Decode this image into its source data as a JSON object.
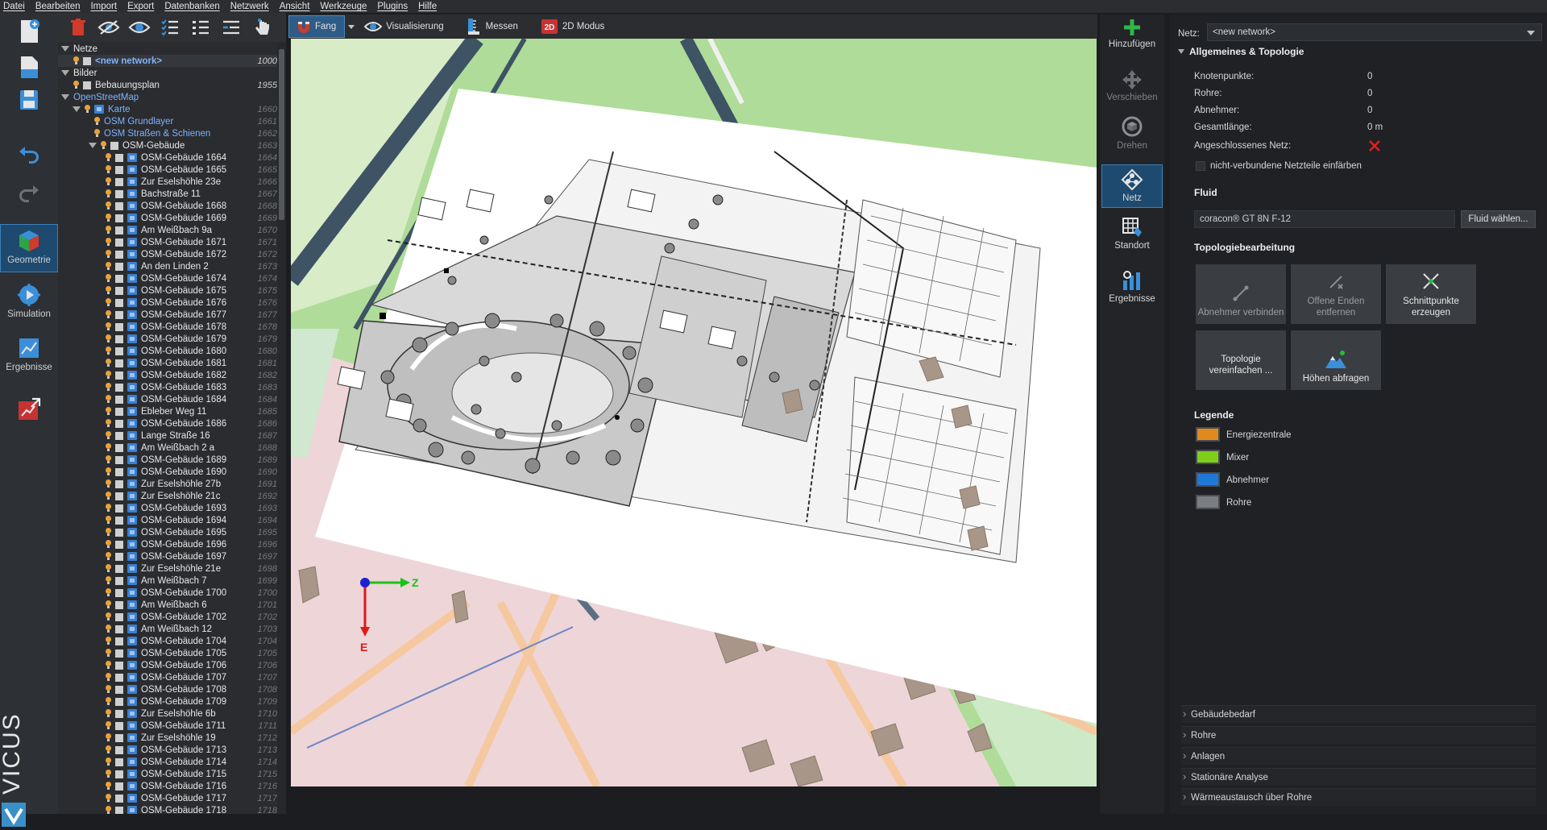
{
  "menu": [
    "Datei",
    "Bearbeiten",
    "Import",
    "Export",
    "Datenbanken",
    "Netzwerk",
    "Ansicht",
    "Werkzeuge",
    "Plugins",
    "Hilfe"
  ],
  "leftbar": {
    "geometry_label": "Geometrie",
    "simulation_label": "Simulation",
    "results_label": "Ergebnisse",
    "logo_text": "VICUS"
  },
  "tree": {
    "groups": {
      "netze": "Netze",
      "new_network": "<new network>",
      "new_network_id": "1000",
      "bilder": "Bilder",
      "bebauungsplan": "Bebauungsplan",
      "bebauungsplan_id": "1955",
      "osm": "OpenStreetMap",
      "karte": "Karte",
      "karte_id": "1660",
      "grundlayer": "OSM Grundlayer",
      "grundlayer_id": "1661",
      "strassen": "OSM Straßen & Schienen",
      "strassen_id": "1662",
      "gebaeude": "OSM-Gebäude",
      "gebaeude_id": "1663"
    },
    "buildings": [
      [
        "OSM-Gebäude 1664",
        "1664"
      ],
      [
        "OSM-Gebäude 1665",
        "1665"
      ],
      [
        "Zur Eselshöhle 23e",
        "1666"
      ],
      [
        "Bachstraße 11",
        "1667"
      ],
      [
        "OSM-Gebäude 1668",
        "1668"
      ],
      [
        "OSM-Gebäude 1669",
        "1669"
      ],
      [
        "Am Weißbach 9a",
        "1670"
      ],
      [
        "OSM-Gebäude 1671",
        "1671"
      ],
      [
        "OSM-Gebäude 1672",
        "1672"
      ],
      [
        "An den Linden 2",
        "1673"
      ],
      [
        "OSM-Gebäude 1674",
        "1674"
      ],
      [
        "OSM-Gebäude 1675",
        "1675"
      ],
      [
        "OSM-Gebäude 1676",
        "1676"
      ],
      [
        "OSM-Gebäude 1677",
        "1677"
      ],
      [
        "OSM-Gebäude 1678",
        "1678"
      ],
      [
        "OSM-Gebäude 1679",
        "1679"
      ],
      [
        "OSM-Gebäude 1680",
        "1680"
      ],
      [
        "OSM-Gebäude 1681",
        "1681"
      ],
      [
        "OSM-Gebäude 1682",
        "1682"
      ],
      [
        "OSM-Gebäude 1683",
        "1683"
      ],
      [
        "OSM-Gebäude 1684",
        "1684"
      ],
      [
        "Ebleber Weg 11",
        "1685"
      ],
      [
        "OSM-Gebäude 1686",
        "1686"
      ],
      [
        "Lange Straße 16",
        "1687"
      ],
      [
        "Am Weißbach 2 a",
        "1688"
      ],
      [
        "OSM-Gebäude 1689",
        "1689"
      ],
      [
        "OSM-Gebäude 1690",
        "1690"
      ],
      [
        "Zur Eselshöhle 27b",
        "1691"
      ],
      [
        "Zur Eselshöhle 21c",
        "1692"
      ],
      [
        "OSM-Gebäude 1693",
        "1693"
      ],
      [
        "OSM-Gebäude 1694",
        "1694"
      ],
      [
        "OSM-Gebäude 1695",
        "1695"
      ],
      [
        "OSM-Gebäude 1696",
        "1696"
      ],
      [
        "OSM-Gebäude 1697",
        "1697"
      ],
      [
        "Zur Eselshöhle 21e",
        "1698"
      ],
      [
        "Am Weißbach 7",
        "1699"
      ],
      [
        "OSM-Gebäude 1700",
        "1700"
      ],
      [
        "Am Weißbach 6",
        "1701"
      ],
      [
        "OSM-Gebäude 1702",
        "1702"
      ],
      [
        "Am Weißbach 12",
        "1703"
      ],
      [
        "OSM-Gebäude 1704",
        "1704"
      ],
      [
        "OSM-Gebäude 1705",
        "1705"
      ],
      [
        "OSM-Gebäude 1706",
        "1706"
      ],
      [
        "OSM-Gebäude 1707",
        "1707"
      ],
      [
        "OSM-Gebäude 1708",
        "1708"
      ],
      [
        "OSM-Gebäude 1709",
        "1709"
      ],
      [
        "Zur Eselshöhle 6b",
        "1710"
      ],
      [
        "OSM-Gebäude 1711",
        "1711"
      ],
      [
        "Zur Eselshöhle 19",
        "1712"
      ],
      [
        "OSM-Gebäude 1713",
        "1713"
      ],
      [
        "OSM-Gebäude 1714",
        "1714"
      ],
      [
        "OSM-Gebäude 1715",
        "1715"
      ],
      [
        "OSM-Gebäude 1716",
        "1716"
      ],
      [
        "OSM-Gebäude 1717",
        "1717"
      ],
      [
        "OSM-Gebäude 1718",
        "1718"
      ]
    ]
  },
  "viewbar": {
    "fang": "Fang",
    "visualisierung": "Visualisierung",
    "messen": "Messen",
    "modus2d": "2D Modus"
  },
  "viewport": {
    "axis_z": "Z",
    "axis_e": "E"
  },
  "toolstrip": {
    "hinzufuegen": "Hinzufügen",
    "verschieben": "Verschieben",
    "drehen": "Drehen",
    "netz": "Netz",
    "standort": "Standort",
    "ergebnisse": "Ergebnisse"
  },
  "props": {
    "netz_label": "Netz:",
    "netz_value": "<new network>",
    "section_general": "Allgemeines & Topologie",
    "knoten_label": "Knotenpunkte:",
    "knoten_value": "0",
    "rohre_label": "Rohre:",
    "rohre_value": "0",
    "abnehmer_label": "Abnehmer:",
    "abnehmer_value": "0",
    "laenge_label": "Gesamtlänge:",
    "laenge_value": "0 m",
    "angeschlossen_label": "Angeschlossenes Netz:",
    "einfaerben_label": "nicht-verbundene Netzteile einfärben",
    "fluid_section": "Fluid",
    "fluid_value": "coracon® GT 8N F-12",
    "fluid_button": "Fluid wählen...",
    "topo_section": "Topologiebearbeitung",
    "btn_abnehmer_verbinden": "Abnehmer verbinden",
    "btn_offene_enden": "Offene Enden entfernen",
    "btn_schnittpunkte": "Schnittpunkte erzeugen",
    "btn_topologie": "Topologie vereinfachen ...",
    "btn_hoehen": "Höhen abfragen",
    "legend_section": "Legende",
    "legend": [
      {
        "label": "Energiezentrale",
        "color": "#e08a1e"
      },
      {
        "label": "Mixer",
        "color": "#7fcf1a"
      },
      {
        "label": "Abnehmer",
        "color": "#1f78d8"
      },
      {
        "label": "Rohre",
        "color": "#7a7d82"
      }
    ],
    "collapsed": [
      "Gebäudebedarf",
      "Rohre",
      "Anlagen",
      "Stationäre Analyse",
      "Wärmeaustausch über Rohre"
    ]
  },
  "colors": {
    "accent": "#3d80b8",
    "error_x": "#e02020",
    "map_green": "#a8d88f",
    "map_pink": "#eacdd1"
  }
}
